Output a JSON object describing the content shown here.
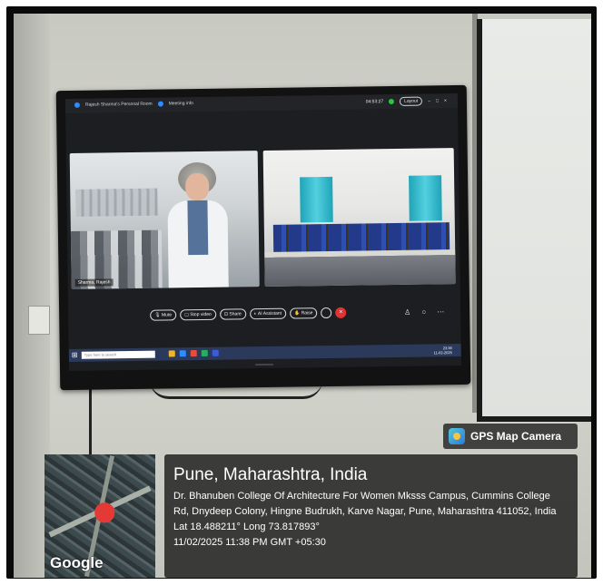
{
  "zoom_window": {
    "room_title": "Rajesh Sharma's Personal Room",
    "meeting_info": "Meeting info",
    "timer": "04:53:27",
    "layout_label": "Layout",
    "participant_name": "Sharma, Rajesh",
    "controls": {
      "mute": "Mute",
      "stop_video": "Stop video",
      "share": "Share",
      "ai_assistant": "AI Assistant",
      "raise": "Raise",
      "end": "×"
    },
    "taskbar": {
      "search_placeholder": "Type here to search",
      "time": "23:38",
      "date": "11-02-2025"
    }
  },
  "gps": {
    "badge": "GPS Map Camera",
    "map_label": "Google",
    "city": "Pune, Maharashtra, India",
    "address": "Dr. Bhanuben College Of Architecture For Women Mksss Campus, Cummins College Rd, Dnydeep Colony, Hingne Budrukh, Karve Nagar, Pune, Maharashtra 411052, India",
    "coords": "Lat 18.488211° Long 73.817893°",
    "timestamp": "11/02/2025 11:38 PM GMT +05:30"
  },
  "colors": {
    "end_call": "#e5312f",
    "curtain": "#1fa4b8",
    "uniform": "#233a8a",
    "pin": "#e53935"
  }
}
